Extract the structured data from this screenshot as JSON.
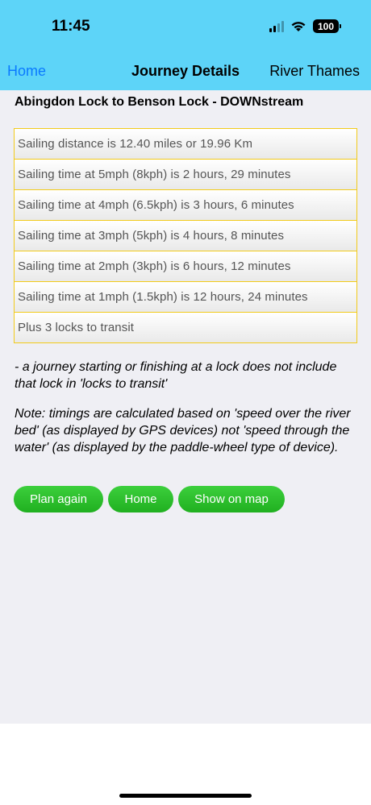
{
  "status_bar": {
    "time": "11:45",
    "battery": "100"
  },
  "nav": {
    "back_label": "Home",
    "title": "Journey Details",
    "right_label": "River Thames"
  },
  "route_title": "Abingdon Lock to Benson Lock - DOWNstream",
  "rows": [
    "Sailing distance is 12.40 miles or 19.96 Km",
    "Sailing time at 5mph (8kph) is 2 hours, 29 minutes",
    "Sailing time at 4mph (6.5kph) is 3 hours, 6 minutes",
    "Sailing time at 3mph (5kph) is 4 hours, 8 minutes",
    "Sailing time at 2mph (3kph) is 6 hours, 12 minutes",
    "Sailing time at 1mph (1.5kph) is 12 hours, 24 minutes",
    "Plus 3 locks to transit"
  ],
  "notes": {
    "lock_note": "- a journey starting or finishing at a lock does not include that lock in 'locks to transit'",
    "timing_note": "Note: timings are calculated based on 'speed over the river bed' (as displayed by GPS devices) not 'speed through the water' (as displayed by the paddle-wheel type of device)."
  },
  "buttons": {
    "plan_again": "Plan again",
    "home": "Home",
    "show_on_map": "Show on map"
  },
  "colors": {
    "header": "#5dd4f8",
    "link": "#0a7aff",
    "row_border": "#f2cb1a",
    "button": "#2dbf2d",
    "content_bg": "#efeff4"
  }
}
